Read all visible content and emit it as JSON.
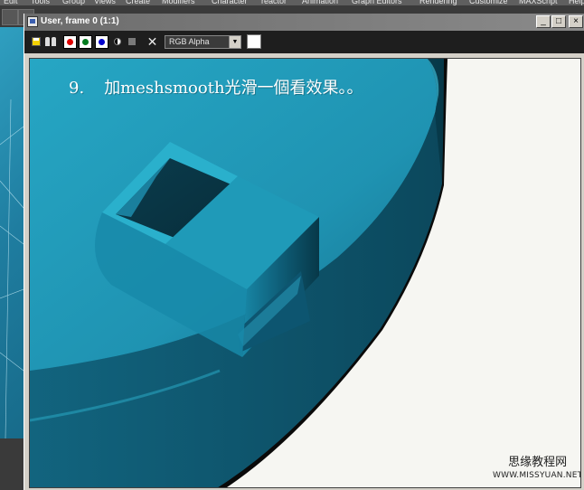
{
  "background_app": {
    "menu_items": [
      "Edit",
      "Tools",
      "Group",
      "Views",
      "Create",
      "Modifiers",
      "Character",
      "reactor",
      "Animation",
      "Graph Editors",
      "Rendering",
      "Customize",
      "MAXScript",
      "Help"
    ]
  },
  "frame_window": {
    "title": "User, frame 0 (1:1)",
    "window_controls": {
      "minimize": "_",
      "maximize": "□",
      "close": "×"
    }
  },
  "frame_toolbar": {
    "channel_select": {
      "value": "RGB Alpha",
      "arrow": "▼"
    },
    "clear_glyph": "✕",
    "swatch_color": "#ffffff"
  },
  "render": {
    "caption": {
      "number": "9.",
      "text": "加meshsmooth光滑一個看效果。。"
    },
    "model_color": "#1f98b5",
    "background_color": "#f6f6f2"
  },
  "watermark": {
    "title": "思缘教程网",
    "url": "WWW.MISSYUAN.NET"
  }
}
